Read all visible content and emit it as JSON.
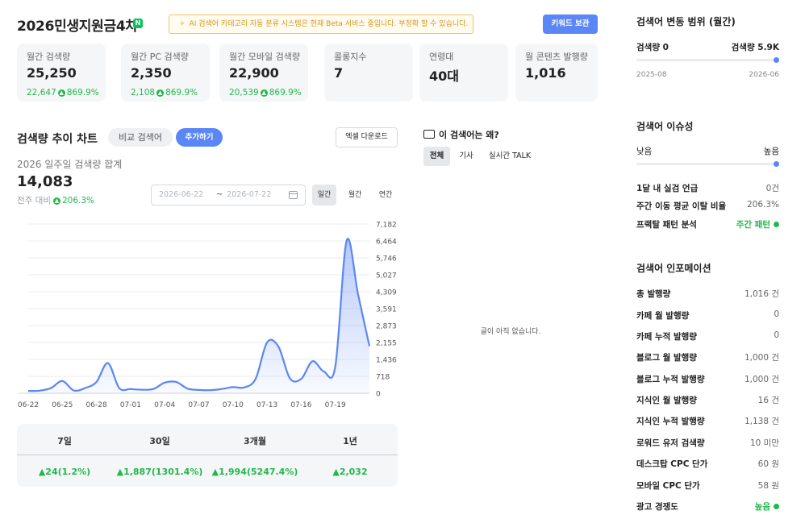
{
  "header": {
    "keyword": "2026민생지원금4차",
    "badge_icon": "naver-n-icon",
    "beta_notice": "AI 검색어 카테고리 자동 분류 시스템은 현재 Beta 서비스 중입니다. 부정확 할 수 있습니다.",
    "beta_icon": "ai-sparkle-icon",
    "keyword_save_button": "키워드 보관"
  },
  "stats": [
    {
      "label": "월간 검색량",
      "value": "25,250",
      "sub_count": "22,647",
      "sub_pct": "869.9%"
    },
    {
      "label": "월간 PC 검색량",
      "value": "2,350",
      "sub_count": "2,108",
      "sub_pct": "869.9%"
    },
    {
      "label": "월간 모바일 검색량",
      "value": "22,900",
      "sub_count": "20,539",
      "sub_pct": "869.9%"
    },
    {
      "label": "콜롱지수",
      "value": "7"
    },
    {
      "label": "연령대",
      "value": "40대"
    },
    {
      "label": "월 콘텐츠 발행량",
      "value": "1,016"
    }
  ],
  "trend": {
    "title": "검색량 추이 차트",
    "compare_button": "비교 검색어",
    "add_button": "추가하기",
    "excel_button": "엑셀 다운로드",
    "week_label": "2026 일주일 검색량 합계",
    "week_value": "14,083",
    "prev_week_label": "전주 대비",
    "prev_week_pct": "206.3%",
    "date_from": "2026-06-22",
    "date_sep": "~",
    "date_to": "2026-07-22",
    "period_tabs": [
      "일간",
      "월간",
      "연간"
    ],
    "active_period": "일간"
  },
  "chart_data": {
    "type": "area",
    "x_tick_labels": [
      "06-22",
      "06-25",
      "06-28",
      "07-01",
      "07-04",
      "07-07",
      "07-10",
      "07-13",
      "07-16",
      "07-19"
    ],
    "y_tick_labels": [
      "7,182",
      "6,464",
      "5,746",
      "5,027",
      "4,309",
      "3,591",
      "2,873",
      "2,155",
      "1,436",
      "718",
      "0"
    ],
    "ylim": [
      0,
      7182
    ],
    "x": [
      "06-22",
      "06-23",
      "06-24",
      "06-25",
      "06-26",
      "06-27",
      "06-28",
      "06-29",
      "06-30",
      "07-01",
      "07-02",
      "07-03",
      "07-04",
      "07-05",
      "07-06",
      "07-07",
      "07-08",
      "07-09",
      "07-10",
      "07-11",
      "07-12",
      "07-13",
      "07-14",
      "07-15",
      "07-16",
      "07-17",
      "07-18",
      "07-19",
      "07-20",
      "07-21",
      "07-22"
    ],
    "values": [
      100,
      110,
      220,
      520,
      120,
      220,
      480,
      1280,
      220,
      180,
      150,
      180,
      450,
      480,
      200,
      140,
      130,
      180,
      260,
      250,
      620,
      2160,
      1980,
      640,
      610,
      1360,
      920,
      1140,
      6480,
      4200,
      2000
    ],
    "series_color": "#5b86f5",
    "grid": true
  },
  "summary": {
    "headers": [
      "7일",
      "30일",
      "3개월",
      "1년"
    ],
    "values": [
      "▲24(1.2%)",
      "▲1,887(1301.4%)",
      "▲1,994(5247.4%)",
      "▲2,032"
    ]
  },
  "why": {
    "title": "이 검색어는 왜?",
    "icon": "chat-bubble-icon",
    "tabs": [
      "전체",
      "기사",
      "실시간 TALK"
    ],
    "empty_message": "글이 아직 없습니다."
  },
  "range_panel": {
    "title": "검색어 변동 범위 (월간)",
    "left_label": "검색량 0",
    "right_label": "검색량 5.9K",
    "start_date": "2025-08",
    "end_date": "2026-06"
  },
  "issue_panel": {
    "title": "검색어 이슈성",
    "low_label": "낮음",
    "high_label": "높음",
    "rows": [
      {
        "label": "1달 내 실검 언급",
        "value": "0건"
      },
      {
        "label": "주간 이동 평균 이탈 비율",
        "value": "206.3%"
      },
      {
        "label": "프랙탈 패턴 분석",
        "value": "주간 패턴"
      }
    ]
  },
  "info_panel": {
    "title": "검색어 인포메이션",
    "rows": [
      {
        "label": "총 발행량",
        "value": "1,016 건"
      },
      {
        "label": "카페 월 발행량",
        "value": "0"
      },
      {
        "label": "카페 누적 발행량",
        "value": "0"
      },
      {
        "label": "블로그 월 발행량",
        "value": "1,000 건"
      },
      {
        "label": "블로그 누적 발행량",
        "value": "1,000 건"
      },
      {
        "label": "지식인 월 발행량",
        "value": "16 건"
      },
      {
        "label": "지식인 누적 발행량",
        "value": "1,138 건"
      },
      {
        "label": "로워드 유저 검색량",
        "value": "10 미만"
      },
      {
        "label": "데스크탑 CPC 단가",
        "value": "60 원"
      },
      {
        "label": "모바일 CPC 단가",
        "value": "58 원"
      },
      {
        "label": "광고 경쟁도",
        "value": "높음"
      }
    ]
  }
}
